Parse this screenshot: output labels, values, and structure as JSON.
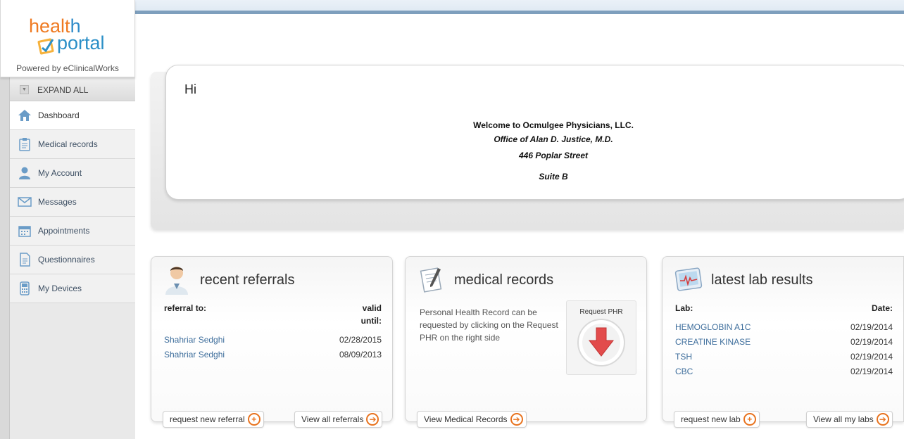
{
  "sidebar": {
    "logo_health": "healt",
    "logo_h": "h",
    "logo_portal": "portal",
    "powered_by": "Powered by eClinicalWorks",
    "expand_all": "EXPAND ALL",
    "items": [
      {
        "label": "Dashboard",
        "icon": "home-icon",
        "active": true
      },
      {
        "label": "Medical records",
        "icon": "clipboard-icon",
        "active": false
      },
      {
        "label": "My Account",
        "icon": "user-icon",
        "active": false
      },
      {
        "label": "Messages",
        "icon": "envelope-icon",
        "active": false
      },
      {
        "label": "Appointments",
        "icon": "calendar-icon",
        "active": false
      },
      {
        "label": "Questionnaires",
        "icon": "document-icon",
        "active": false
      },
      {
        "label": "My Devices",
        "icon": "device-icon",
        "active": false
      }
    ]
  },
  "welcome": {
    "greeting": "Hi",
    "line1": "Welcome to Ocmulgee Physicians, LLC.",
    "line2": "Office of Alan D. Justice, M.D.",
    "line3": "446 Poplar Street",
    "line4": "Suite B"
  },
  "referrals": {
    "title": "recent referrals",
    "col_left": "referral to:",
    "col_right_1": "valid",
    "col_right_2": "until:",
    "rows": [
      {
        "name": "Shahriar Sedghi",
        "date": "02/28/2015"
      },
      {
        "name": "Shahriar Sedghi",
        "date": "08/09/2013"
      }
    ],
    "btn_new": "request new referral",
    "btn_all": "View all referrals"
  },
  "medical": {
    "title": "medical records",
    "text": "Personal Health Record can be requested by clicking on the Request PHR on the right side",
    "request_label": "Request PHR",
    "btn_view": "View Medical Records"
  },
  "labs": {
    "title": "latest lab results",
    "col_left": "Lab:",
    "col_right": "Date:",
    "rows": [
      {
        "name": "HEMOGLOBIN A1C",
        "date": "02/19/2014"
      },
      {
        "name": "CREATINE KINASE",
        "date": "02/19/2014"
      },
      {
        "name": "TSH",
        "date": "02/19/2014"
      },
      {
        "name": "CBC",
        "date": "02/19/2014"
      }
    ],
    "btn_new": "request new lab",
    "btn_all": "View all my labs"
  },
  "colors": {
    "accent_orange": "#e8731f",
    "link_blue": "#3e6e9c",
    "logo_orange": "#ef7a22",
    "logo_blue": "#2b8fc7"
  }
}
